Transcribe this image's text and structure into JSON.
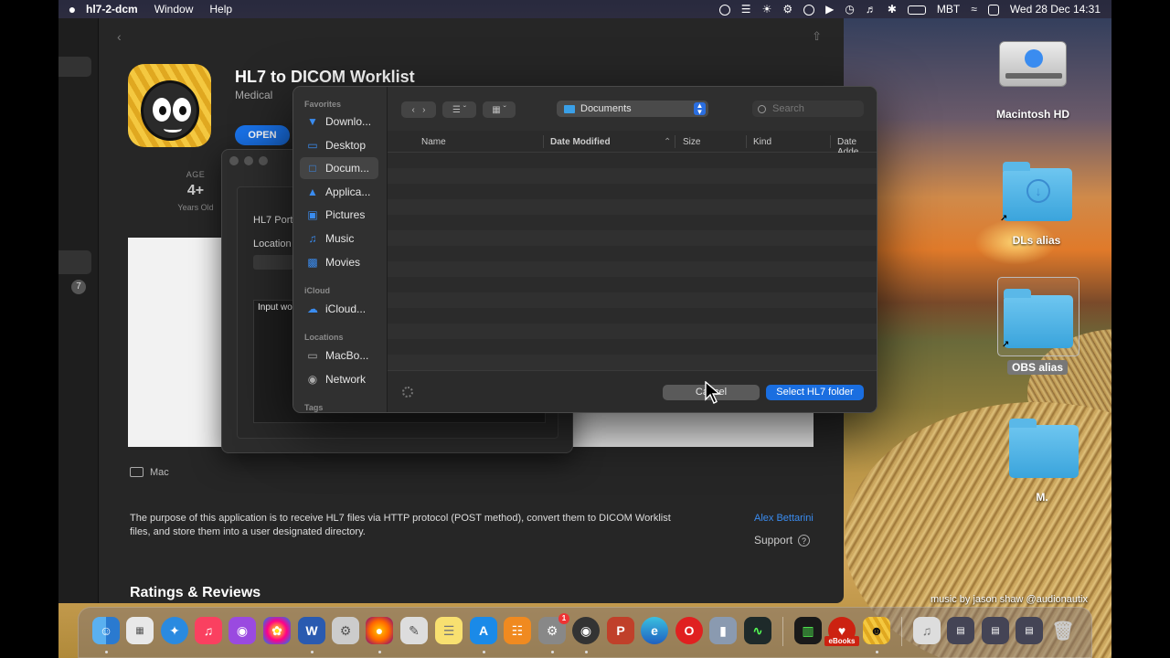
{
  "menubar": {
    "app_name": "hl7-2-dcm",
    "menus": [
      "Window",
      "Help"
    ],
    "input_source": "MBT",
    "datetime": "Wed 28 Dec  14:31"
  },
  "store": {
    "app_title": "HL7 to DICOM Worklist",
    "category": "Medical",
    "open_label": "OPEN",
    "age_label": "AGE",
    "age_value": "4+",
    "age_sub": "Years Old",
    "platform": "Mac",
    "description": "The purpose of this application is to receive HL7 files via HTTP protocol (POST method), convert them to DICOM Worklist files, and store them into a user designated directory.",
    "developer": "Alex Bettarini",
    "support": "Support",
    "ratings_heading": "Ratings & Reviews",
    "sidebar_badge": "7"
  },
  "bg_dialog": {
    "port_label": "HL7 Port",
    "location_label": "Location",
    "textarea_label": "Input wor"
  },
  "file_dialog": {
    "sidebar": {
      "favorites_heading": "Favorites",
      "favorites": [
        {
          "label": "Downlo...",
          "icon": "download-icon"
        },
        {
          "label": "Desktop",
          "icon": "desktop-icon"
        },
        {
          "label": "Docum...",
          "icon": "document-icon"
        },
        {
          "label": "Applica...",
          "icon": "applications-icon"
        },
        {
          "label": "Pictures",
          "icon": "pictures-icon"
        },
        {
          "label": "Music",
          "icon": "music-icon"
        },
        {
          "label": "Movies",
          "icon": "movies-icon"
        }
      ],
      "icloud_heading": "iCloud",
      "icloud": [
        {
          "label": "iCloud...",
          "icon": "cloud-icon"
        }
      ],
      "locations_heading": "Locations",
      "locations": [
        {
          "label": "MacBo...",
          "icon": "laptop-icon"
        },
        {
          "label": "Network",
          "icon": "globe-icon"
        }
      ],
      "tags_heading": "Tags"
    },
    "location": "Documents",
    "search_placeholder": "Search",
    "columns": {
      "name": "Name",
      "date_modified": "Date Modified",
      "size": "Size",
      "kind": "Kind",
      "date_added": "Date Adde"
    },
    "cancel_label": "Cancel",
    "select_label": "Select HL7 folder"
  },
  "desktop": {
    "icons": {
      "hd": "Macintosh HD",
      "dls": "DLs alias",
      "obs": "OBS alias",
      "m": "M."
    },
    "credit": "music by jason shaw @audionautix"
  },
  "dock": {
    "ebooks_label": "eBooks",
    "system_prefs_badge": "1"
  },
  "colors": {
    "accent": "#1a6ee0",
    "link": "#3a8cf0"
  }
}
